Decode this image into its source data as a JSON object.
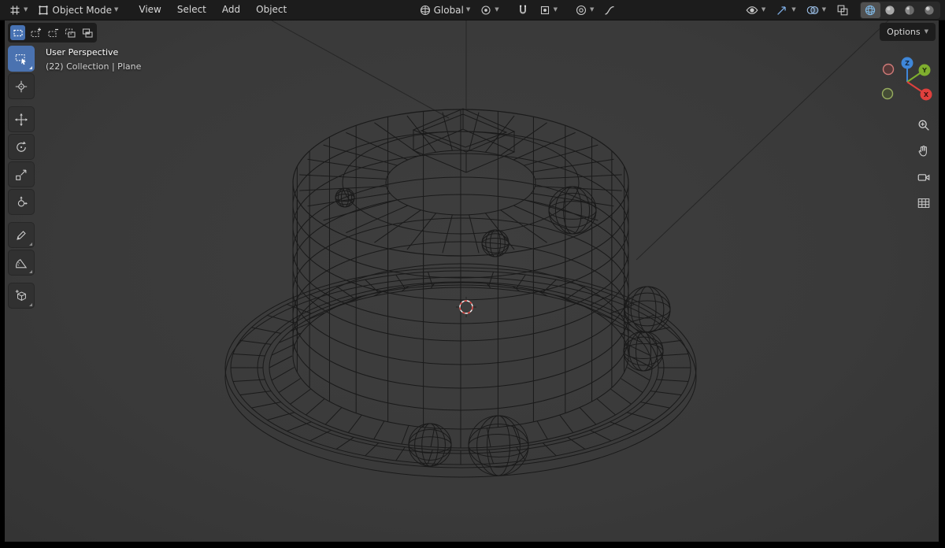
{
  "header": {
    "mode_selector": {
      "label": "Object Mode"
    },
    "menus": [
      {
        "label": "View"
      },
      {
        "label": "Select"
      },
      {
        "label": "Add"
      },
      {
        "label": "Object"
      }
    ],
    "transform_orientation": {
      "label": "Global"
    }
  },
  "tool_settings": {
    "options_button": {
      "label": "Options"
    }
  },
  "viewport_overlay": {
    "view_name": "User Perspective",
    "collection_breadcrumb": "(22) Collection | Plane"
  },
  "nav_gizmo": {
    "axis_x": "X",
    "axis_y": "Y",
    "axis_z": "Z"
  },
  "icons": {
    "topbar_left": [
      "editor-type-icon",
      "object-mode-icon",
      "dropdown-chevron-icon"
    ],
    "topbar_center": [
      "orientation-globe-icon",
      "pivot-point-icon",
      "snap-magnet-icon",
      "snap-target-icon",
      "proportional-editing-icon",
      "falloff-curve-icon"
    ],
    "topbar_right": [
      "visibility-eye-icon",
      "gizmos-icon",
      "overlays-icon",
      "xray-toggle-icon",
      "wireframe-shading-icon",
      "solid-shading-icon",
      "material-preview-icon",
      "rendered-shading-icon"
    ],
    "toolbar": [
      "select-box-icon",
      "cursor-icon",
      "move-icon",
      "rotate-icon",
      "scale-icon",
      "transform-icon",
      "annotate-icon",
      "measure-icon",
      "add-cube-icon"
    ],
    "select_modes": [
      "set-mode-icon",
      "extend-mode-icon",
      "subtract-mode-icon",
      "invert-mode-icon",
      "intersect-mode-icon"
    ],
    "viewport_side": [
      "zoom-icon",
      "pan-hand-icon",
      "camera-view-icon",
      "toggle-grid-icon"
    ],
    "scene": [
      "wireframe-cake-model",
      "3d-cursor"
    ]
  },
  "colors": {
    "accent_blue": "#4772b3",
    "header_bg": "#1c1c1c",
    "panel_bg": "#1d1d1d",
    "viewport_bg": "#3b3b3b",
    "wireframe_stroke": "#1a1a1a",
    "lamp_line": "#262626",
    "axis_x": "#e0403d",
    "axis_y": "#7fae2e",
    "axis_z": "#3f87d9",
    "cursor_red": "#e2403c",
    "text_light": "#d5d5d5"
  }
}
